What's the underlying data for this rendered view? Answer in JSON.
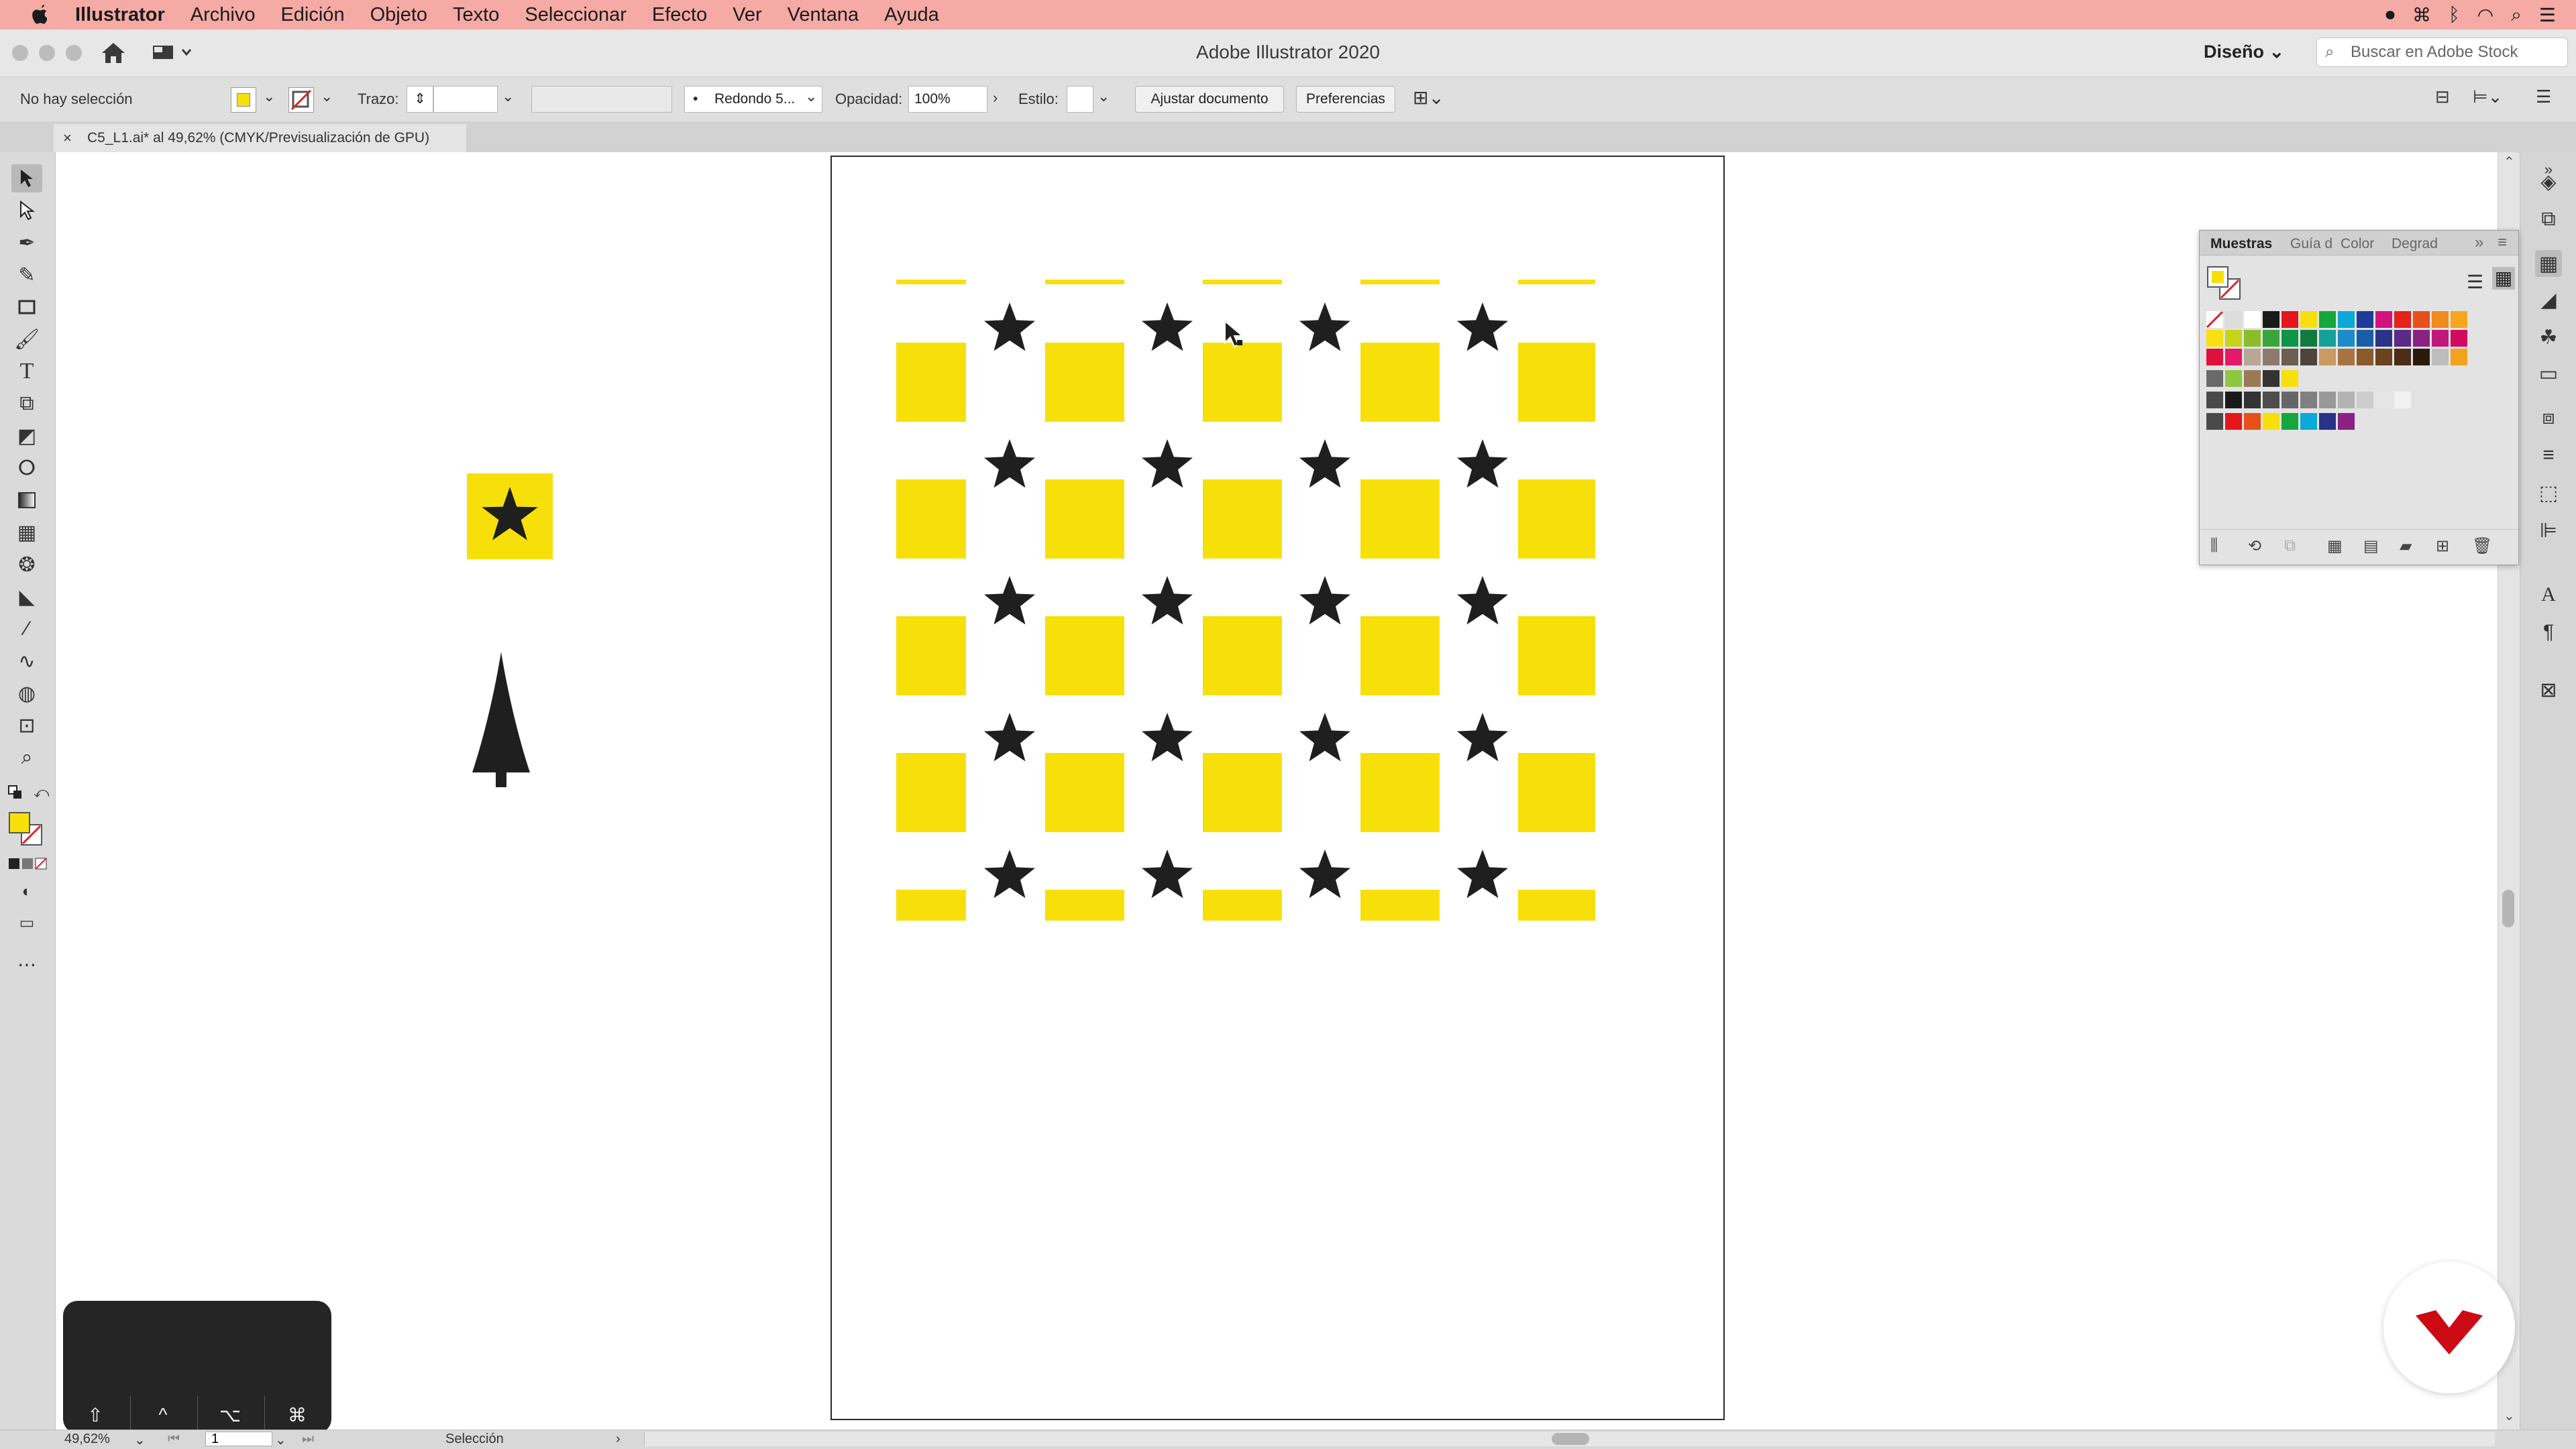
{
  "menubar": {
    "app_name": "Illustrator",
    "items": [
      "Archivo",
      "Edición",
      "Objeto",
      "Texto",
      "Seleccionar",
      "Efecto",
      "Ver",
      "Ventana",
      "Ayuda"
    ]
  },
  "titlebar": {
    "title": "Adobe Illustrator 2020",
    "workspace": "Diseño",
    "search_placeholder": "Buscar en Adobe Stock"
  },
  "controlbar": {
    "selection_status": "No hay selección",
    "stroke_label": "Trazo:",
    "brush_value": "Redondo 5...",
    "opacity_label": "Opacidad:",
    "opacity_value": "100%",
    "style_label": "Estilo:",
    "fit_document_button": "Ajustar documento",
    "preferences_button": "Preferencias"
  },
  "document": {
    "tab_title": "C5_L1.ai* al 49,62% (CMYK/Previsualización de GPU)"
  },
  "swatches_panel": {
    "tabs": [
      "Muestras",
      "Guía d",
      "Color",
      "Degrad"
    ]
  },
  "statusbar": {
    "zoom": "49,62%",
    "artboard_number": "1",
    "tool_name": "Selección"
  },
  "key_overlay": {
    "keys": [
      "⇧",
      "^",
      "⌥",
      "⌘"
    ]
  },
  "colors": {
    "pattern_yellow": "#f7e00a",
    "star_fill": "#1f1f1f",
    "menubar_bg": "#f5aaa5",
    "logo_red": "#cc0a14"
  }
}
